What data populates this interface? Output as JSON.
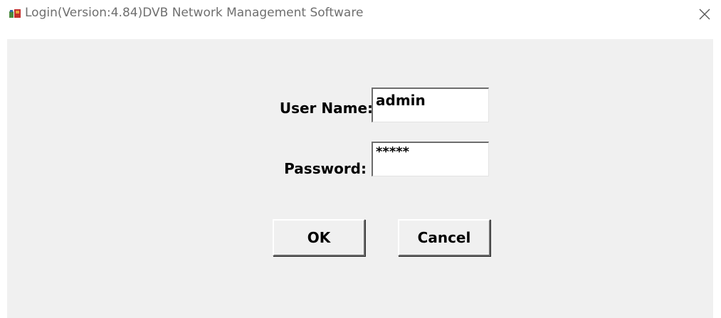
{
  "window": {
    "title": "Login(Version:4.84)DVB Network Management Software",
    "icon": "app-icon"
  },
  "form": {
    "username_label": "User Name:",
    "username_value": "admin",
    "password_label": "Password:",
    "password_value": "*****"
  },
  "buttons": {
    "ok_label": "OK",
    "cancel_label": "Cancel"
  }
}
